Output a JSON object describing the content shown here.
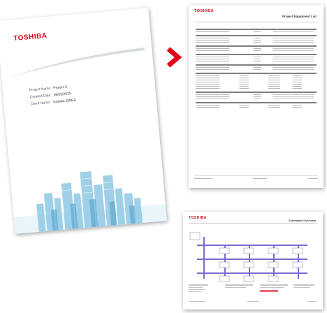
{
  "cover": {
    "brand": "TOSHIBA",
    "project_name_label": "Project Name:",
    "project_name_value": "Project A",
    "created_date_label": "Created Date:",
    "created_date_value": "06/02/2015",
    "client_name_label": "Client Name:",
    "client_name_value": "Toshiba EWEA"
  },
  "equipment_page": {
    "brand": "TOSHIBA",
    "title": "Project Equipment List"
  },
  "schematic_page": {
    "brand": "TOSHIBA",
    "title": "Schematic Overview"
  },
  "colors": {
    "brand_red": "#e2001a",
    "pipe_purple": "#7b6bd0",
    "city_blue": "#8fc8e4"
  },
  "icons": [
    "chevron-right-icon",
    "city-skyline-icon"
  ]
}
